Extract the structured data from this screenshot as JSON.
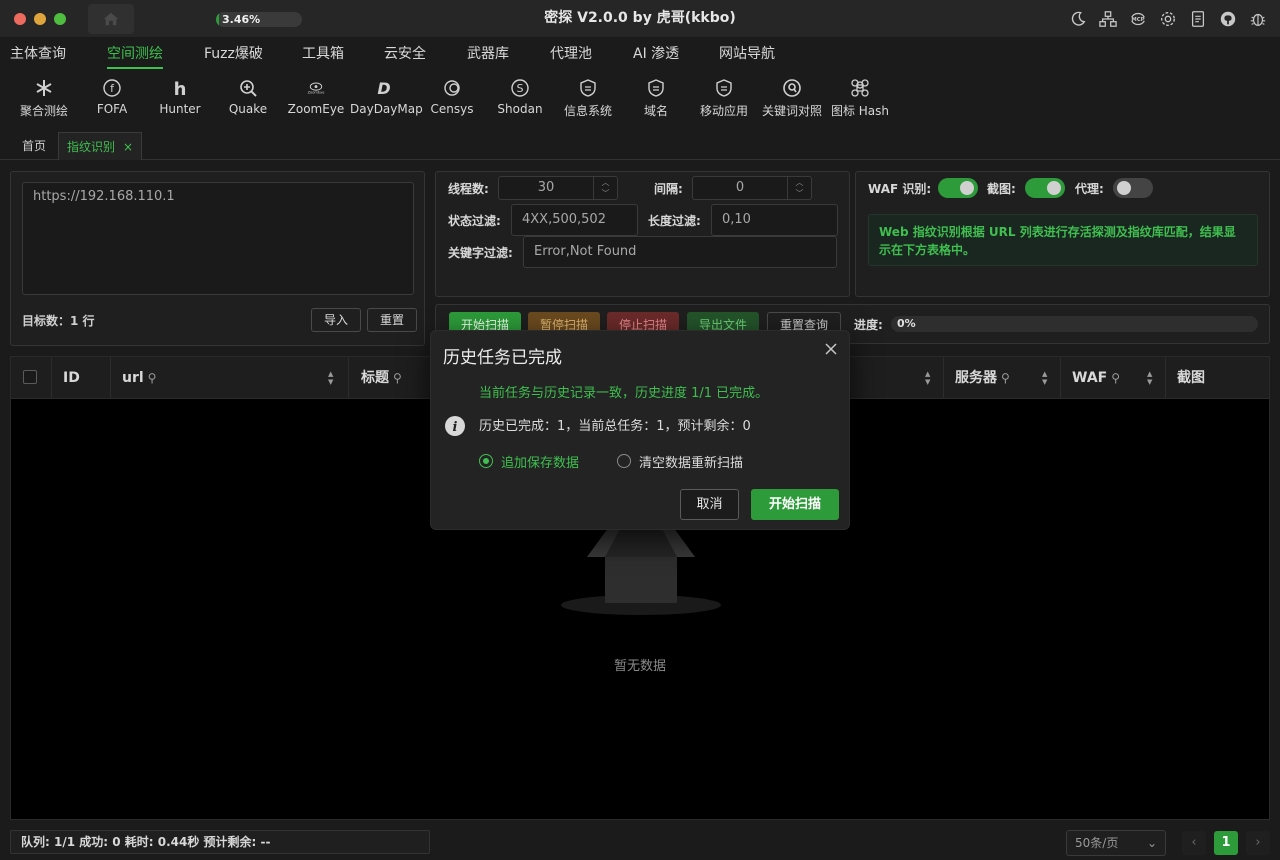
{
  "window": {
    "title": "密探 V2.0.0 by 虎哥(kkbo)",
    "cpu_usage": "3.46%",
    "cpu_fraction": 0.0346
  },
  "title_icons": [
    "moon-icon",
    "network-icon",
    "mcp-icon",
    "gear-icon",
    "document-icon",
    "github-icon",
    "bug-icon"
  ],
  "title_icon_text": {
    "mcp": "MCP"
  },
  "menu": {
    "items": [
      {
        "label": "主体查询"
      },
      {
        "label": "空间测绘",
        "active": true
      },
      {
        "label": "Fuzz爆破"
      },
      {
        "label": "工具箱"
      },
      {
        "label": "云安全"
      },
      {
        "label": "武器库"
      },
      {
        "label": "代理池"
      },
      {
        "label": "AI 渗透"
      },
      {
        "label": "网站导航"
      }
    ]
  },
  "toolbar": {
    "items": [
      {
        "label": "聚合测绘",
        "icon": "asterisk-icon"
      },
      {
        "label": "FOFA",
        "icon": "fofa-icon"
      },
      {
        "label": "Hunter",
        "icon": "hunter-icon"
      },
      {
        "label": "Quake",
        "icon": "quake-icon"
      },
      {
        "label": "ZoomEye",
        "icon": "zoomeye-icon"
      },
      {
        "label": "DayDayMap",
        "icon": "daydaymap-icon"
      },
      {
        "label": "Censys",
        "icon": "censys-icon"
      },
      {
        "label": "Shodan",
        "icon": "shodan-icon"
      },
      {
        "label": "信息系统",
        "icon": "shield-icon"
      },
      {
        "label": "域名",
        "icon": "shield-icon"
      },
      {
        "label": "移动应用",
        "icon": "shield-icon"
      },
      {
        "label": "关键词对照",
        "icon": "search-icon"
      },
      {
        "label": "图标 Hash",
        "icon": "cmd-icon"
      }
    ],
    "glyphs": {
      "fofa": "f",
      "hunter": "h",
      "shodan": "S",
      "daydaymap": "D",
      "zoomeye": "ZoomEye"
    }
  },
  "page_tabs": {
    "home": "首页",
    "fingerprint": "指纹识别",
    "close": "×"
  },
  "target": {
    "value": "https://192.168.110.1",
    "count_label": "目标数：",
    "count_value": "1 行",
    "import_label": "导入",
    "reset_label": "重置"
  },
  "params": {
    "threads_label": "线程数:",
    "threads_value": "30",
    "interval_label": "间隔:",
    "interval_value": "0",
    "status_filter_label": "状态过滤:",
    "status_filter_value": "4XX,500,502",
    "length_filter_label": "长度过滤:",
    "length_filter_value": "0,10",
    "keyword_filter_label": "关键字过滤:",
    "keyword_filter_value": "Error,Not Found",
    "stepper_up": "︿",
    "stepper_down": "﹀"
  },
  "options": {
    "waf_label": "WAF 识别:",
    "waf_on": true,
    "screenshot_label": "截图:",
    "screenshot_on": true,
    "proxy_label": "代理:",
    "proxy_on": false,
    "info": "Web 指纹识别根据 URL 列表进行存活探测及指纹库匹配，结果显示在下方表格中。"
  },
  "actions": {
    "start": "开始扫描",
    "pause": "暂停扫描",
    "stop": "停止扫描",
    "export": "导出文件",
    "requery": "重置查询",
    "progress_label": "进度:",
    "progress_value": "0%"
  },
  "table": {
    "columns": [
      {
        "label": "ID"
      },
      {
        "label": "url",
        "searchable": true,
        "sortable": true
      },
      {
        "label": "标题",
        "searchable": true
      },
      {
        "label": "服务器",
        "searchable": true,
        "sortable": true
      },
      {
        "label": "WAF",
        "searchable": true,
        "sortable": true
      },
      {
        "label": "截图"
      }
    ],
    "empty_text": "暂无数据"
  },
  "status_bar": {
    "text": "队列: 1/1 成功: 0 耗时: 0.44秒 预计剩余: --"
  },
  "pagination": {
    "page_size": "50条/页",
    "current_page": "1",
    "prev": "‹",
    "next": "›",
    "chevron": "⌄"
  },
  "modal": {
    "title": "历史任务已完成",
    "message": "当前任务与历史记录一致，历史进度 1/1 已完成。",
    "detail": "历史已完成：1，当前总任务：1，预计剩余：0",
    "option_append": "追加保存数据",
    "option_clear": "清空数据重新扫描",
    "selected": "append",
    "cancel_label": "取消",
    "start_label": "开始扫描"
  },
  "colors": {
    "accent": "#3fbf4f",
    "background": "#1b1b1b"
  }
}
